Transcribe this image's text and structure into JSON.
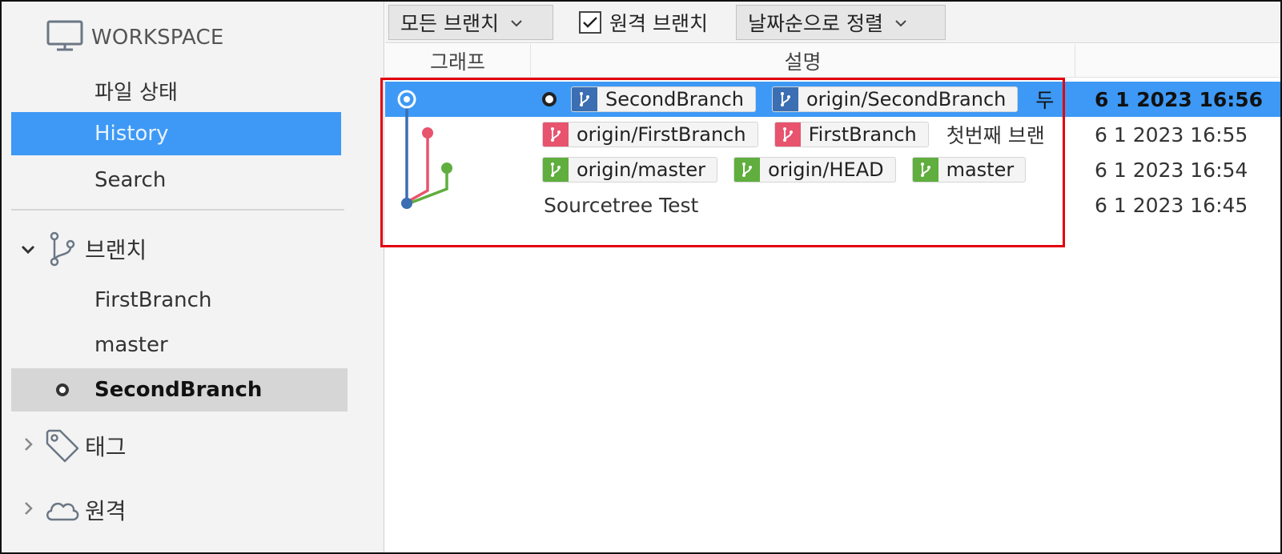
{
  "sidebar": {
    "workspace_label": "WORKSPACE",
    "items": [
      {
        "label": "파일 상태"
      },
      {
        "label": "History"
      },
      {
        "label": "Search"
      }
    ],
    "branches_section": {
      "label": "브랜치",
      "expanded": true
    },
    "branches": [
      {
        "label": "FirstBranch"
      },
      {
        "label": "master"
      },
      {
        "label": "SecondBranch",
        "current": true
      }
    ],
    "tags_section": {
      "label": "태그"
    },
    "remotes_section": {
      "label": "원격"
    }
  },
  "toolbar": {
    "branch_filter": "모든 브랜치",
    "remote_branches_label": "원격 브랜치",
    "remote_branches_checked": true,
    "sort_order": "날짜순으로 정렬"
  },
  "columns": {
    "graph": "그래프",
    "description": "설명"
  },
  "commits": [
    {
      "refs": [
        {
          "label": "SecondBranch",
          "color": "#3b6eb2"
        },
        {
          "label": "origin/SecondBranch",
          "color": "#3b6eb2"
        }
      ],
      "message": "두",
      "date": "6 1 2023 16:56",
      "selected": true
    },
    {
      "refs": [
        {
          "label": "origin/FirstBranch",
          "color": "#e8536e"
        },
        {
          "label": "FirstBranch",
          "color": "#e8536e"
        }
      ],
      "message": "첫번째 브랜",
      "date": "6 1 2023 16:55"
    },
    {
      "refs": [
        {
          "label": "origin/master",
          "color": "#5fae3e"
        },
        {
          "label": "origin/HEAD",
          "color": "#5fae3e"
        },
        {
          "label": "master",
          "color": "#5fae3e"
        }
      ],
      "message": "",
      "date": "6 1 2023 16:54"
    },
    {
      "refs": [],
      "message": "Sourcetree Test",
      "date": "6 1 2023 16:45"
    }
  ],
  "colors": {
    "selection": "#3d99f5",
    "highlight_box": "#e3000f",
    "branch_blue": "#3b6eb2",
    "branch_red": "#e8536e",
    "branch_green": "#5fae3e"
  }
}
